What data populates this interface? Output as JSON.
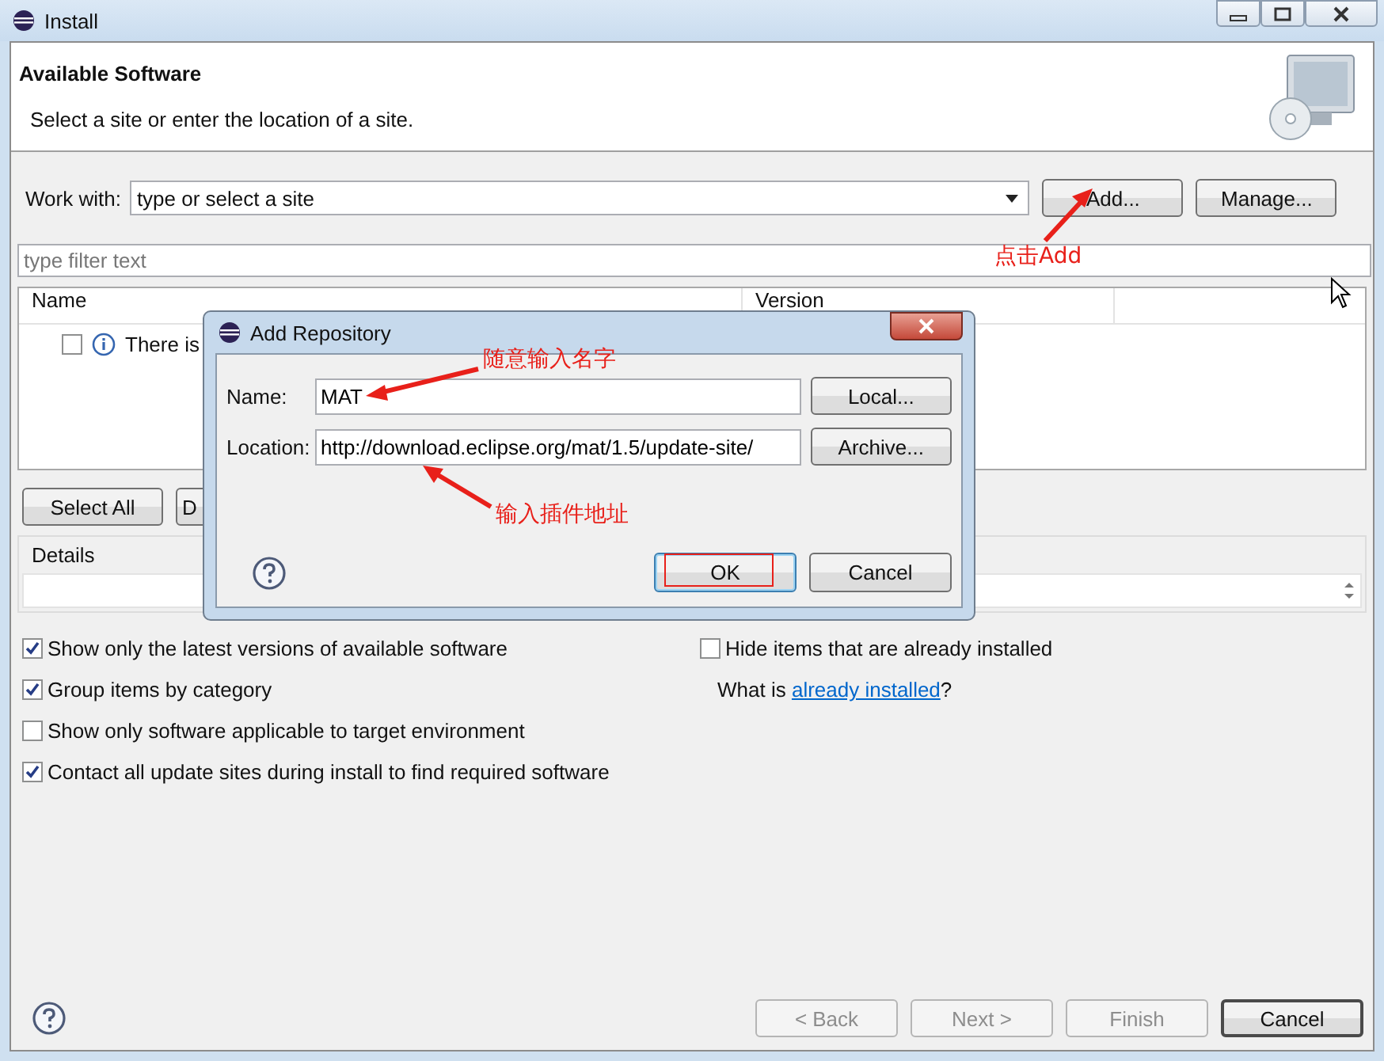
{
  "window": {
    "title": "Install"
  },
  "header": {
    "title": "Available Software",
    "subtitle": "Select a site or enter the location of a site."
  },
  "work_with": {
    "label": "Work with:",
    "placeholder": "type or select a site",
    "buttons": [
      {
        "label": "Add..."
      },
      {
        "label": "Manage..."
      }
    ]
  },
  "filter": {
    "placeholder": "type filter text"
  },
  "table": {
    "columns": [
      "Name",
      "Version"
    ],
    "rows": [
      {
        "checked": false,
        "name": "There is"
      }
    ]
  },
  "selection_buttons": [
    "Select All",
    "D"
  ],
  "details": {
    "label": "Details"
  },
  "options": [
    {
      "label": "Show only the latest versions of available software",
      "checked": true
    },
    {
      "label": "Group items by category",
      "checked": true
    },
    {
      "label": "Show only software applicable to target environment",
      "checked": false
    },
    {
      "label": "Contact all update sites during install to find required software",
      "checked": true
    }
  ],
  "hide_installed": {
    "label": "Hide items that are already installed",
    "checked": false
  },
  "what_is": {
    "before": "What is ",
    "link": "already installed",
    "after": "?"
  },
  "footer_buttons": [
    {
      "label": "< Back",
      "disabled": true
    },
    {
      "label": "Next >",
      "disabled": true
    },
    {
      "label": "Finish",
      "disabled": true
    },
    {
      "label": "Cancel",
      "disabled": false
    }
  ],
  "dialog": {
    "title": "Add Repository",
    "fields": [
      {
        "label": "Name:",
        "value": "MAT",
        "button": "Local..."
      },
      {
        "label": "Location:",
        "value": "http://download.eclipse.org/mat/1.5/update-site/",
        "button": "Archive..."
      }
    ],
    "buttons": [
      "OK",
      "Cancel"
    ]
  },
  "annotations": [
    {
      "text": "点击Add"
    },
    {
      "text": "随意输入名字"
    },
    {
      "text": "输入插件地址"
    }
  ]
}
